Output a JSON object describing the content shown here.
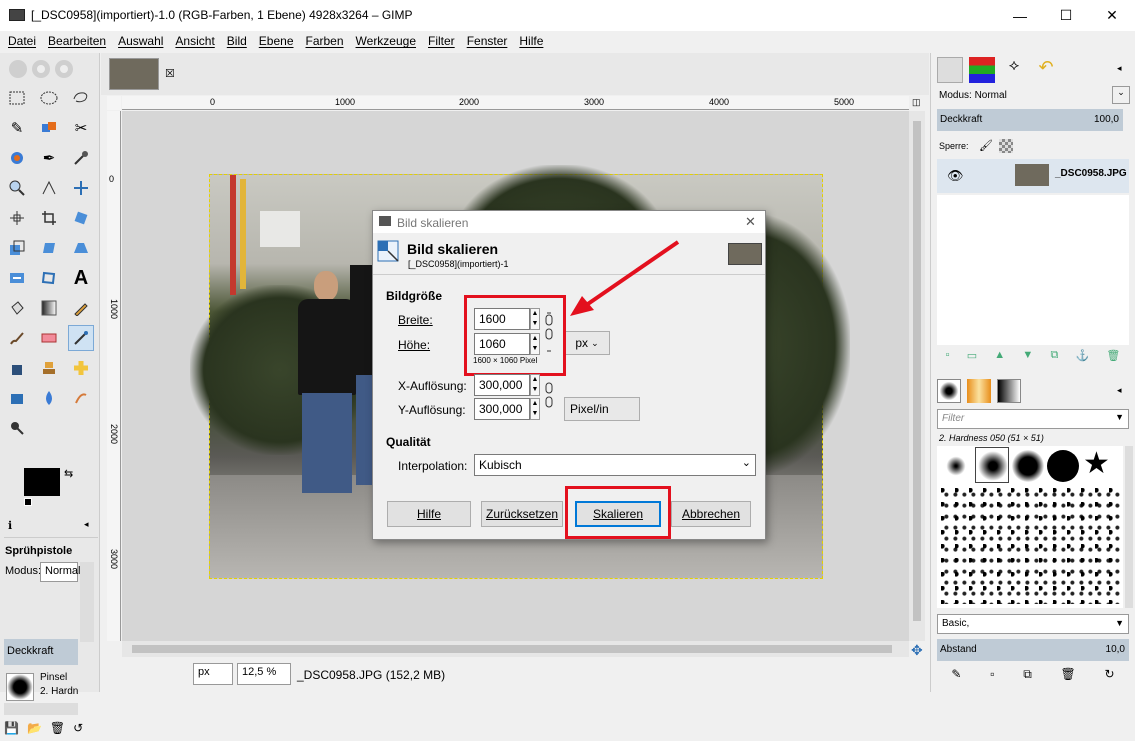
{
  "window": {
    "title": "[_DSC0958](importiert)-1.0 (RGB-Farben, 1 Ebene) 4928x3264 – GIMP",
    "minimize": "—",
    "maximize": "☐",
    "close": "✕"
  },
  "menu": [
    "Datei",
    "Bearbeiten",
    "Auswahl",
    "Ansicht",
    "Bild",
    "Ebene",
    "Farben",
    "Werkzeuge",
    "Filter",
    "Fenster",
    "Hilfe"
  ],
  "ruler": {
    "labels": [
      "0",
      "1000",
      "2000",
      "3000",
      "4000",
      "5000"
    ],
    "vlabels": [
      "0",
      "1000",
      "2000",
      "3000"
    ]
  },
  "tool_options": {
    "title": "Sprühpistole",
    "mode_label": "Modus:",
    "mode_value": "Normal",
    "opacity_label": "Deckkraft",
    "brush_label": "Pinsel",
    "brush_value": "2. Hardn"
  },
  "status": {
    "unit": "px",
    "zoom": "12,5 %",
    "file_info": "_DSC0958.JPG (152,2 MB)"
  },
  "dialog": {
    "window_title": "Bild skalieren",
    "heading": "Bild skalieren",
    "subheading": "[_DSC0958](importiert)-1",
    "section_size": "Bildgröße",
    "width_label": "Breite:",
    "width_value": "1600",
    "height_label": "Höhe:",
    "height_value": "1060",
    "size_info": "1600 × 1060 Pixel",
    "size_unit": "px",
    "xres_label": "X-Auflösung:",
    "xres_value": "300,000",
    "yres_label": "Y-Auflösung:",
    "yres_value": "300,000",
    "res_unit": "Pixel/in",
    "section_quality": "Qualität",
    "interp_label": "Interpolation:",
    "interp_value": "Kubisch",
    "btn_help": "Hilfe",
    "btn_reset": "Zurücksetzen",
    "btn_scale": "Skalieren",
    "btn_cancel": "Abbrechen"
  },
  "layers": {
    "mode_label": "Modus: Normal",
    "opacity_label": "Deckkraft",
    "opacity_value": "100,0",
    "lock_label": "Sperre:",
    "layer_name": "_DSC0958.JPG"
  },
  "brushes": {
    "filter_placeholder": "Filter",
    "selected_brush": "2. Hardness 050 (51 × 51)",
    "preset": "Basic,",
    "spacing_label": "Abstand",
    "spacing_value": "10,0"
  },
  "colors": {
    "accent_red": "#e3101e",
    "focus_blue": "#0078d7",
    "selection": "#e5d100"
  }
}
